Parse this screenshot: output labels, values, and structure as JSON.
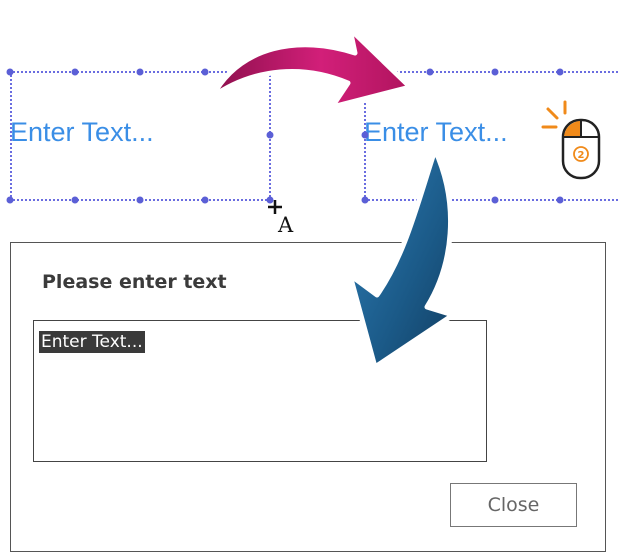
{
  "canvas": {
    "left_frame_text": "Enter Text...",
    "right_frame_text": "Enter Text..."
  },
  "dialog": {
    "title": "Please enter text",
    "textbox_value": "Enter Text...",
    "close_label": "Close"
  },
  "colors": {
    "frame_outline": "#6a6de0",
    "frame_text": "#3a8ee6",
    "top_arrow": "#c2186a",
    "bottom_arrow": "#1d5c8c",
    "mouse_accent": "#f08a1a"
  },
  "icons": [
    "curved-arrow-right-icon",
    "curved-arrow-down-icon",
    "text-cursor-icon",
    "mouse-double-click-icon"
  ]
}
